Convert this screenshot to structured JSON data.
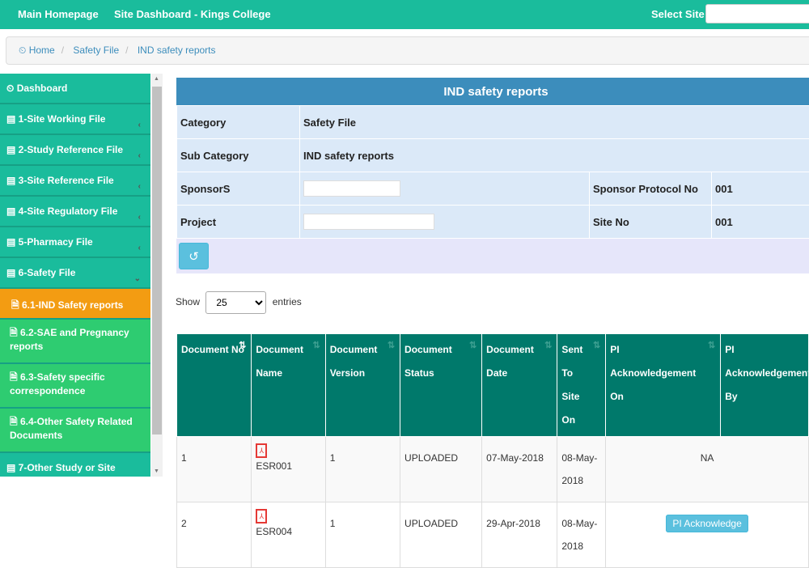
{
  "topbar": {
    "home": "Main Homepage",
    "dashboard": "Site Dashboard - Kings College",
    "select_site": "Select Site",
    "site_value": ""
  },
  "breadcrumb": {
    "home": "Home",
    "category": "Safety File",
    "current": "IND safety reports"
  },
  "sidebar": {
    "items": [
      {
        "label": "Dashboard",
        "icon": "dashboard-icon"
      },
      {
        "label": "1-Site Working File",
        "icon": "list-icon"
      },
      {
        "label": "2-Study Reference File",
        "icon": "list-icon"
      },
      {
        "label": "3-Site Reference File",
        "icon": "list-icon"
      },
      {
        "label": "4-Site Regulatory File",
        "icon": "list-icon"
      },
      {
        "label": "5-Pharmacy File",
        "icon": "list-icon"
      },
      {
        "label": "6-Safety File",
        "icon": "list-icon"
      }
    ],
    "subitems": [
      {
        "label": "6.1-IND Safety reports",
        "active": true
      },
      {
        "label": "6.2-SAE and Pregnancy reports"
      },
      {
        "label": "6.3-Safety specific correspondence"
      },
      {
        "label": "6.4-Other Safety Related Documents"
      }
    ],
    "last": "7-Other Study or Site"
  },
  "panel": {
    "title": "IND safety reports",
    "category_label": "Category",
    "category": "Safety File",
    "subcategory_label": "Sub Category",
    "subcategory": "IND safety reports",
    "sponsors_label": "SponsorS",
    "sponsors": "",
    "protocol_label": "Sponsor Protocol No",
    "protocol": "001",
    "project_label": "Project",
    "project": "",
    "site_label": "Site No",
    "site": "001"
  },
  "length": {
    "show": "Show",
    "value": "25",
    "entries": "entries"
  },
  "table": {
    "headers": [
      "Document No",
      "Document Name",
      "Document Version",
      "Document Status",
      "Document Date",
      "Sent To Site On",
      "PI Acknowledgement On",
      "PI Acknowledgement By"
    ],
    "rows": [
      {
        "no": "1",
        "name": "ESR001",
        "version": "1",
        "status": "UPLOADED",
        "date": "07-May-2018",
        "sent": "08-May-2018",
        "ack": "NA"
      },
      {
        "no": "2",
        "name": "ESR004",
        "version": "1",
        "status": "UPLOADED",
        "date": "29-Apr-2018",
        "sent": "08-May-2018",
        "ack_button": "PI Acknowledge"
      }
    ]
  },
  "colors": {
    "topbar": "#1abc9c",
    "active": "#f39c12",
    "subitem": "#2ecc71",
    "header": "#00796b",
    "panel": "#3c8dbc"
  }
}
